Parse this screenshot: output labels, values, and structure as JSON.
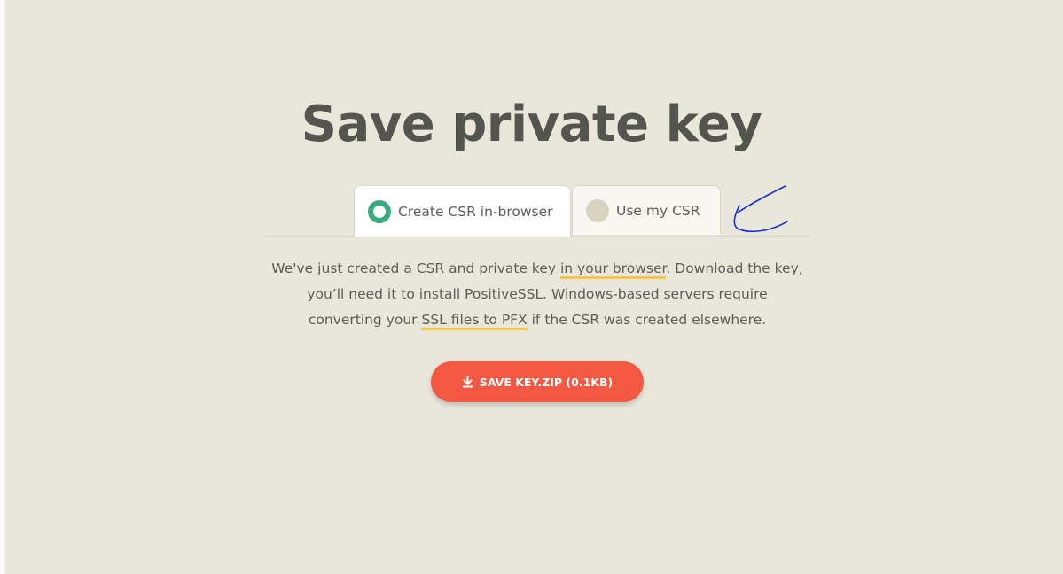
{
  "page": {
    "title": "Save private key"
  },
  "tabs": [
    {
      "label": "Create CSR in-browser",
      "selected": true
    },
    {
      "label": "Use my CSR",
      "selected": false
    }
  ],
  "description": {
    "line1_a": "We've just created a CSR and private key ",
    "line1_link": "in your browser",
    "line1_b": ". Download the key,",
    "line2": "you’ll need it to install PositiveSSL. Windows-based servers require",
    "line3_a": "converting your ",
    "line3_link": "SSL files to PFX",
    "line3_b": " if the CSR was created elsewhere."
  },
  "save_button": {
    "label": "SAVE KEY.ZIP (0.1KB)",
    "icon": "download-icon"
  },
  "colors": {
    "background": "#e9e7da",
    "accent_green": "#3aaa7e",
    "button_red": "#f35843",
    "highlight_yellow": "#f2c94c",
    "annotation_blue": "#1a2fd0"
  }
}
